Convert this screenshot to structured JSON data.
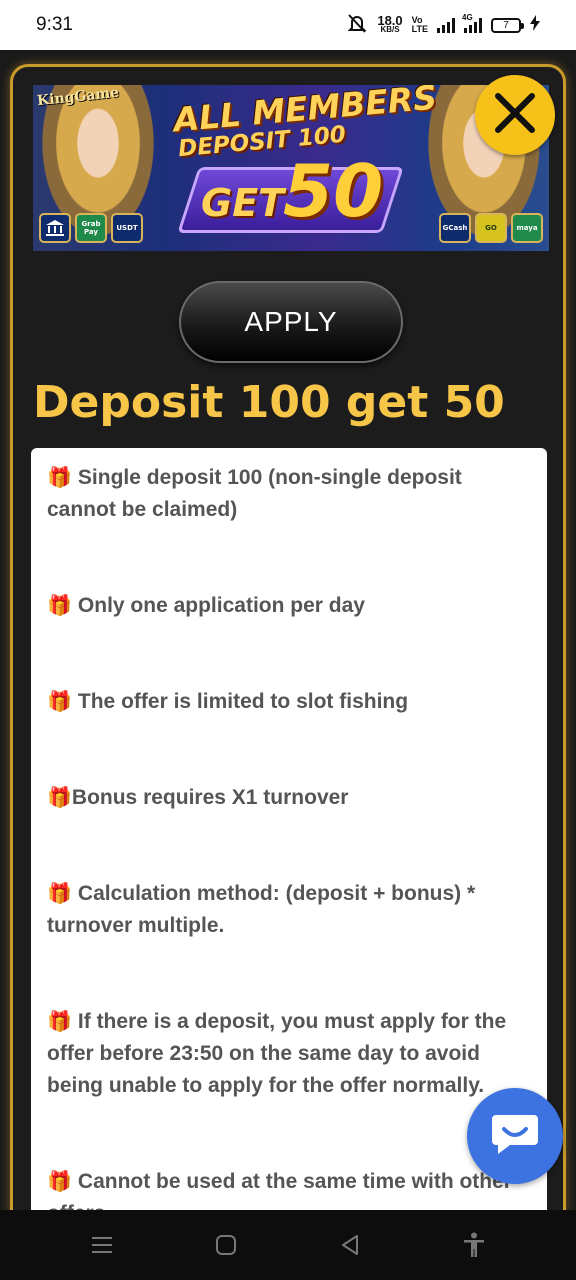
{
  "status_bar": {
    "time": "9:31",
    "speed_value": "18.0",
    "speed_unit": "KB/S",
    "volte_top": "Vo",
    "volte_bottom": "LTE",
    "net_type": "4G",
    "battery": "7"
  },
  "banner": {
    "brand": "KingGame",
    "headline": "ALL MEMBERS",
    "subline": "DEPOSIT 100",
    "get": "GET",
    "amount": "50",
    "pay_left": [
      "Grab Pay",
      "USDT"
    ],
    "pay_right": [
      "GCash",
      "GO",
      "maya"
    ]
  },
  "modal": {
    "apply_label": "APPLY",
    "title": "Deposit 100 get 50"
  },
  "rules": [
    {
      "icon": "🎁",
      "text": "Single deposit 100 (non-single deposit cannot be claimed)"
    },
    {
      "icon": "🎁",
      "text": "Only one application per day"
    },
    {
      "icon": "🎁",
      "text": "The offer is limited to slot fishing"
    },
    {
      "icon": "🎁",
      "text": "Bonus requires X1 turnover"
    },
    {
      "icon": "🎁",
      "text": "Calculation method: (deposit + bonus) * turnover multiple."
    },
    {
      "icon": "🎁",
      "text": "If there is a deposit, you must apply for the offer before 23:50 on the same day to avoid being unable to apply for the offer normally."
    },
    {
      "icon": "🎁",
      "text": "Cannot be used at the same time with other offers"
    }
  ],
  "colors": {
    "accent_gold": "#f7c548",
    "close_yellow": "#f6c21a",
    "chat_blue": "#3d73e0",
    "modal_border": "#c79a2b"
  },
  "icons": {
    "close": "close-icon",
    "chat": "chat-bubble-icon",
    "gift": "gift-icon"
  }
}
